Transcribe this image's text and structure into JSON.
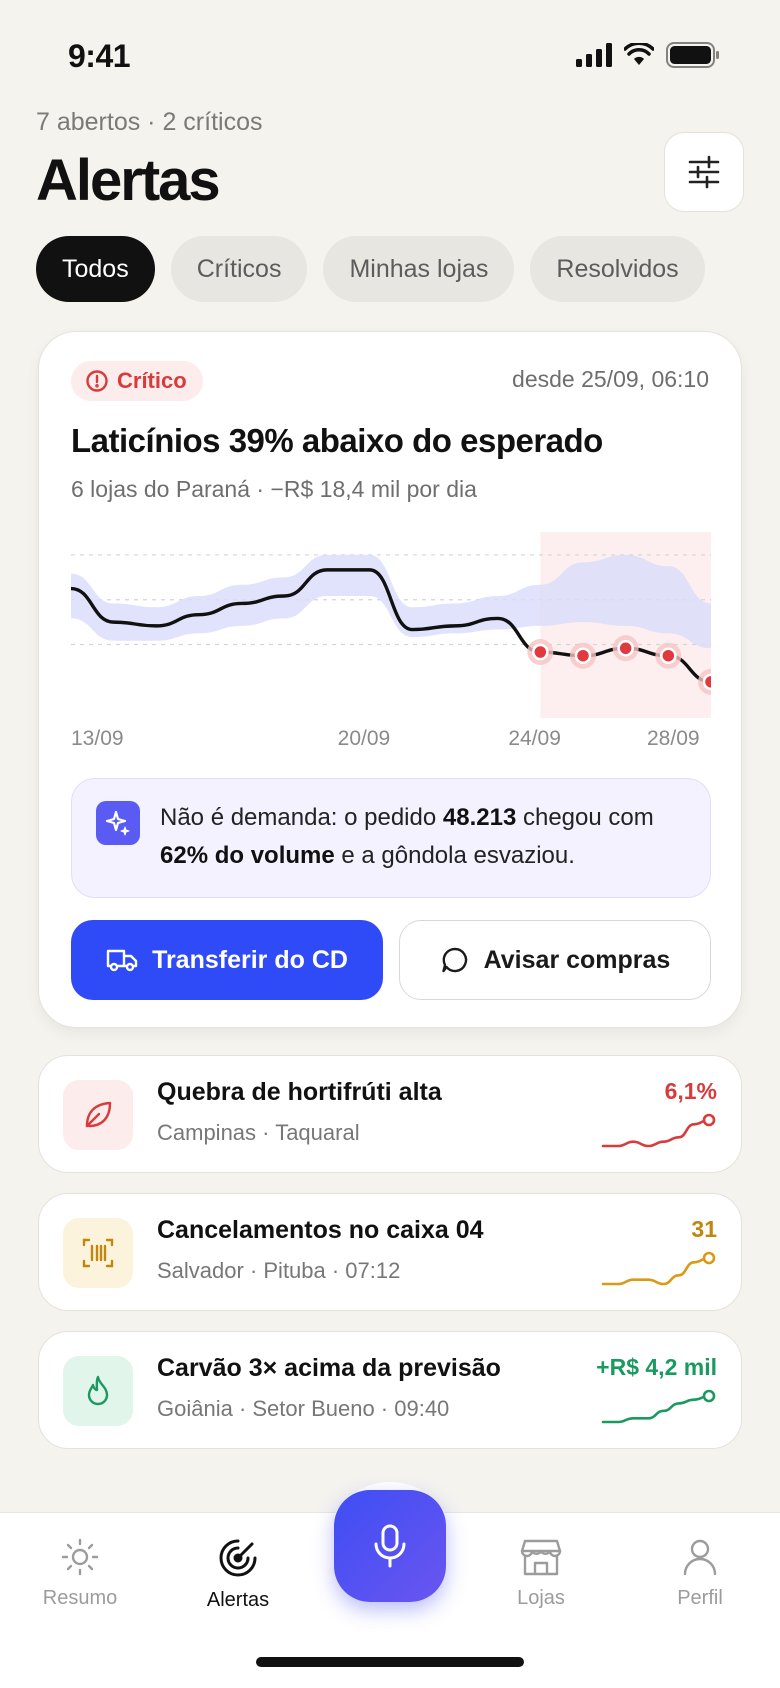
{
  "status_bar": {
    "time": "9:41"
  },
  "header": {
    "summary": "7 abertos · 2 críticos",
    "title": "Alertas"
  },
  "filters": [
    {
      "label": "Todos",
      "active": true
    },
    {
      "label": "Críticos",
      "active": false
    },
    {
      "label": "Minhas lojas",
      "active": false
    },
    {
      "label": "Resolvidos",
      "active": false
    }
  ],
  "main_alert": {
    "badge": "Crítico",
    "since": "desde 25/09, 06:10",
    "title": "Laticínios 39% abaixo do esperado",
    "subtitle": "6 lojas do Paraná · −R$ 18,4 mil por dia",
    "x_labels": [
      "13/09",
      "20/09",
      "24/09",
      "28/09"
    ],
    "insight": {
      "text_1": "Não é demanda: o pedido ",
      "bold_1": "48.213",
      "text_2": " chegou com ",
      "bold_2": "62% do volume",
      "text_3": " e a gôndola esvaziou."
    },
    "primary_action": "Transferir do CD",
    "secondary_action": "Avisar compras",
    "colors": {
      "critical": "#D83B3B",
      "primary": "#2F4BF8",
      "band": "#DCE0FB"
    }
  },
  "chart_data": {
    "type": "line",
    "x": [
      13,
      14,
      15,
      16,
      17,
      18,
      19,
      20,
      21,
      22,
      23,
      24,
      25,
      26,
      27,
      28
    ],
    "x_tick_labels": [
      "13/09",
      "20/09",
      "24/09",
      "28/09"
    ],
    "series": [
      {
        "values": [
          94,
          76,
          74,
          80,
          86,
          90,
          104,
          104,
          72,
          74,
          78,
          60,
          58,
          62,
          58,
          44
        ],
        "role": "actual"
      },
      {
        "values_low": [
          78,
          66,
          66,
          70,
          74,
          78,
          90,
          90,
          68,
          70,
          72,
          74,
          76,
          74,
          70,
          62
        ],
        "values_high": [
          102,
          86,
          84,
          90,
          96,
          100,
          112,
          112,
          84,
          86,
          90,
          96,
          108,
          112,
          106,
          86
        ],
        "role": "expected-band"
      }
    ],
    "highlight_from": 24,
    "alert_points": [
      24,
      25,
      26,
      27,
      28
    ],
    "ylim": [
      30,
      120
    ],
    "grid": true
  },
  "other_alerts": [
    {
      "title": "Quebra de hortifrúti alta",
      "subtitle": "Campinas · Taquaral",
      "metric": "6,1%",
      "color": "#D83B3B",
      "icon_bg": "#FDECEC",
      "icon": "leaf-icon",
      "spark": [
        4,
        4,
        5,
        4,
        5,
        6,
        9,
        10
      ]
    },
    {
      "title": "Cancelamentos no caixa 04",
      "subtitle": "Salvador · Pituba · 07:12",
      "metric": "31",
      "color": "#D99A16",
      "icon_bg": "#FCF3DC",
      "icon": "barcode-scan-icon",
      "spark": [
        4,
        4,
        5,
        5,
        4,
        6,
        9,
        10
      ]
    },
    {
      "title": "Carvão 3× acima da previsão",
      "subtitle": "Goiânia · Setor Bueno · 09:40",
      "metric": "+R$ 4,2 mil",
      "color": "#1A9A60",
      "icon_bg": "#E2F5EB",
      "icon": "flame-icon",
      "spark": [
        3,
        3,
        4,
        4,
        6,
        8,
        9,
        10
      ]
    }
  ],
  "tabbar": {
    "tabs": [
      {
        "label": "Resumo",
        "icon": "sun-icon"
      },
      {
        "label": "Alertas",
        "icon": "radar-icon",
        "active": true
      },
      {
        "label": "Lojas",
        "icon": "store-icon"
      },
      {
        "label": "Perfil",
        "icon": "user-icon"
      }
    ]
  }
}
